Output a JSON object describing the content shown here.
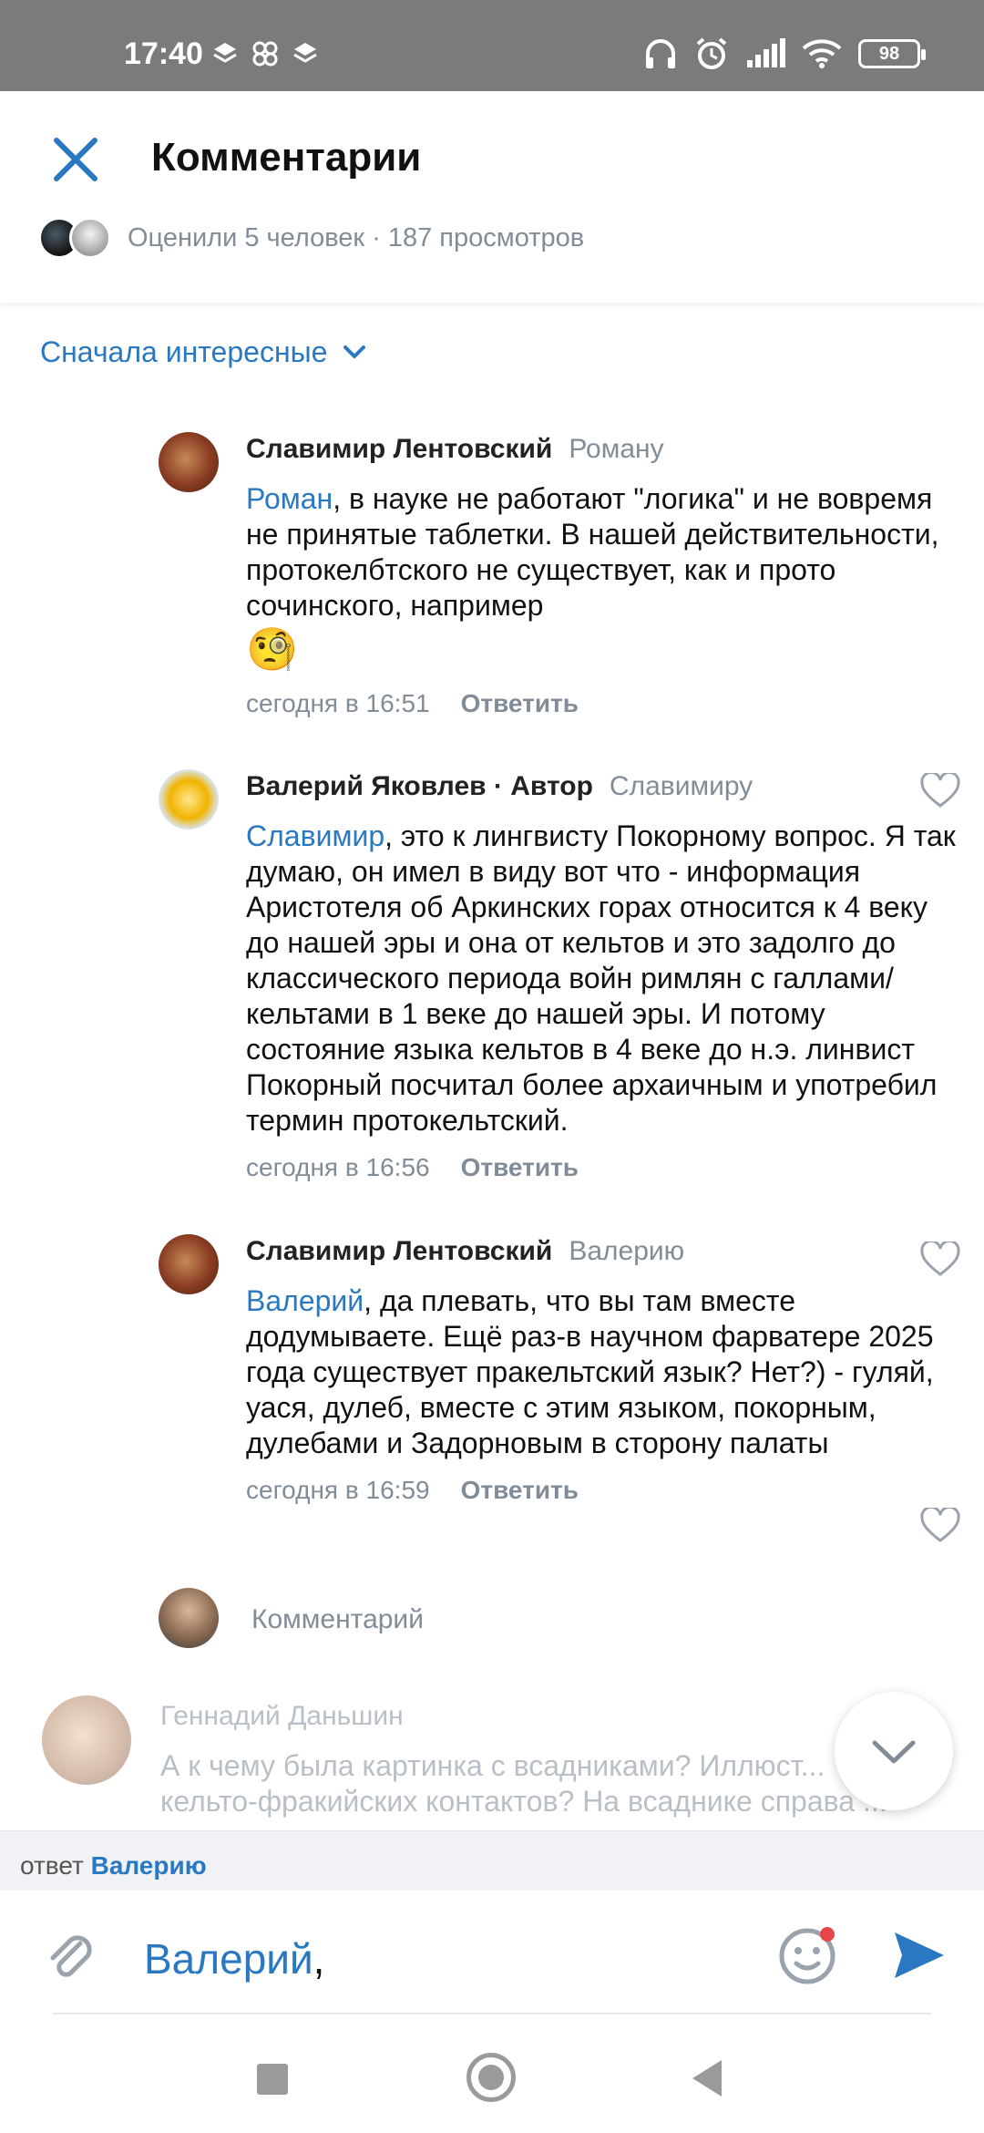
{
  "status": {
    "time": "17:40",
    "battery": "98"
  },
  "header": {
    "title": "Комментарии",
    "stats": "Оценили 5 человек · 187 просмотров"
  },
  "sort": {
    "label": "Сначала интересные"
  },
  "comments": [
    {
      "author": "Славимир Лентовский",
      "to": "Роману",
      "mention": "Роман",
      "text": ", в науке не работают \"логика\"  и не вовремя не принятые таблетки. В нашей действительности, протокелбтского не существует, как и прото сочинского, например",
      "emoji": "🧐",
      "time": "сегодня в 16:51",
      "reply": "Ответить"
    },
    {
      "author": "Валерий Яковлев · Автор",
      "to": "Славимиру",
      "mention": "Славимир",
      "text": ", это к лингвисту Покорному вопрос. Я так думаю, он имел в виду вот что - информация Аристотеля об Аркинских горах относится к 4 веку до нашей эры и она от кельтов и это задолго до классического периода войн римлян с галлами/кельтами в 1 веке до нашей эры. И потому состояние языка кельтов в 4 веке до н.э. линвист Покорный посчитал более архаичным и употребил термин протокельтский.",
      "time": "сегодня в 16:56",
      "reply": "Ответить"
    },
    {
      "author": "Славимир Лентовский",
      "to": "Валерию",
      "mention": "Валерий",
      "text": ", да плевать, что вы там вместе додумываете. Ещё раз-в научном фарватере 2025 года существует пракельтский язык? Нет?) - гуляй, уася, дулеб, вместе с этим языком, покорным, дулебами и Задорновым в сторону палаты",
      "time": "сегодня в 16:59",
      "reply": "Ответить"
    }
  ],
  "inline_input": {
    "placeholder": "Комментарий"
  },
  "next_comment": {
    "author": "Геннадий Даньшин",
    "text": "А к чему была картинка с всадниками? Иллюст... кельто-фракийских контактов? На всаднике справа ..."
  },
  "reply_bar": {
    "prefix": "ответ",
    "who": "Валерию"
  },
  "composer": {
    "mention": "Валерий",
    "rest": ","
  },
  "colors": {
    "accent": "#2a78c2",
    "muted": "#818c99",
    "statusbar": "#7b7b7b"
  }
}
